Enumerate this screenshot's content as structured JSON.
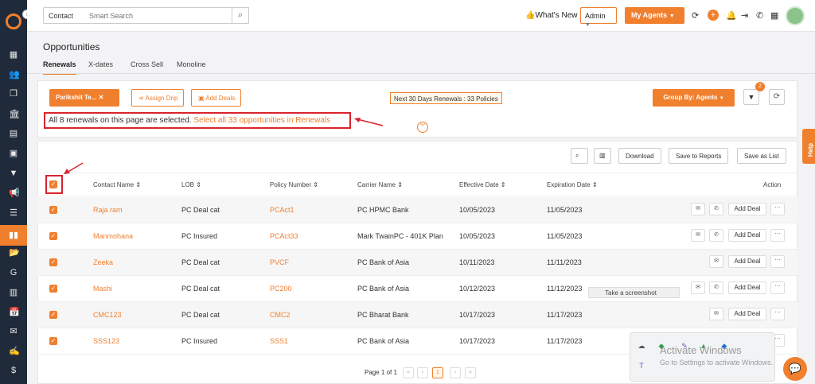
{
  "topbar": {
    "contact_select": "Contact",
    "search_placeholder": "Smart Search",
    "whats_new": "What's New",
    "admin_select": "Admin",
    "my_agents": "My Agents"
  },
  "page": {
    "title": "Opportunities",
    "tabs": [
      {
        "label": "Renewals"
      },
      {
        "label": "X-dates"
      },
      {
        "label": "Cross Sell"
      },
      {
        "label": "Monoline"
      }
    ]
  },
  "toolbar": {
    "agent_chip": "Parikshit Te...",
    "assign_drip": "Assign Drip",
    "add_deals": "Add Deals",
    "next30": "Next 30 Days Renewals : 33 Policies",
    "group_by": "Group By: Agents",
    "filter_badge": "2"
  },
  "selection": {
    "message": "All 8 renewals on this page are selected.",
    "link": "Select all 33 opportunities in Renewals"
  },
  "help": "Help",
  "table_tools": {
    "download": "Download",
    "save_reports": "Save to Reports",
    "save_list": "Save as List"
  },
  "table": {
    "headers": [
      "Contact Name",
      "LOB",
      "Policy Number",
      "Carrier Name",
      "Effective Date",
      "Expiration Date",
      "Action"
    ],
    "rows": [
      {
        "contact": "Raja ram",
        "lob": "PC Deal cat",
        "policy": "PCAct1",
        "carrier": "PC HPMC Bank",
        "effective": "10/05/2023",
        "expiration": "11/05/2023"
      },
      {
        "contact": "Manmohana",
        "lob": "PC Insured",
        "policy": "PCAct33",
        "carrier": "Mark TwainPC - 401K Plan",
        "effective": "10/05/2023",
        "expiration": "11/05/2023"
      },
      {
        "contact": "Zeeka",
        "lob": "PC Deal cat",
        "policy": "PVCF",
        "carrier": "PC Bank of Asia",
        "effective": "10/11/2023",
        "expiration": "11/11/2023"
      },
      {
        "contact": "Mashi",
        "lob": "PC Deal cat",
        "policy": "PC200",
        "carrier": "PC Bank of Asia",
        "effective": "10/12/2023",
        "expiration": "11/12/2023"
      },
      {
        "contact": "CMC123",
        "lob": "PC Deal cat",
        "policy": "CMC2",
        "carrier": "PC Bharat Bank",
        "effective": "10/17/2023",
        "expiration": "11/17/2023"
      },
      {
        "contact": "SSS123",
        "lob": "PC Insured",
        "policy": "SSS1",
        "carrier": "PC Bank of Asia",
        "effective": "10/17/2023",
        "expiration": "11/17/2023"
      }
    ],
    "add_deal": "Add Deal"
  },
  "tooltip": "Take a screenshot",
  "pagination": {
    "label": "Page 1 of 1",
    "current": "1"
  },
  "os": {
    "activate_title": "Activate Windows",
    "activate_sub": "Go to Settings to activate Windows."
  },
  "colors": {
    "accent": "#f07f2e",
    "sidebar": "#1f2b3a",
    "highlight": "#d9232d"
  }
}
